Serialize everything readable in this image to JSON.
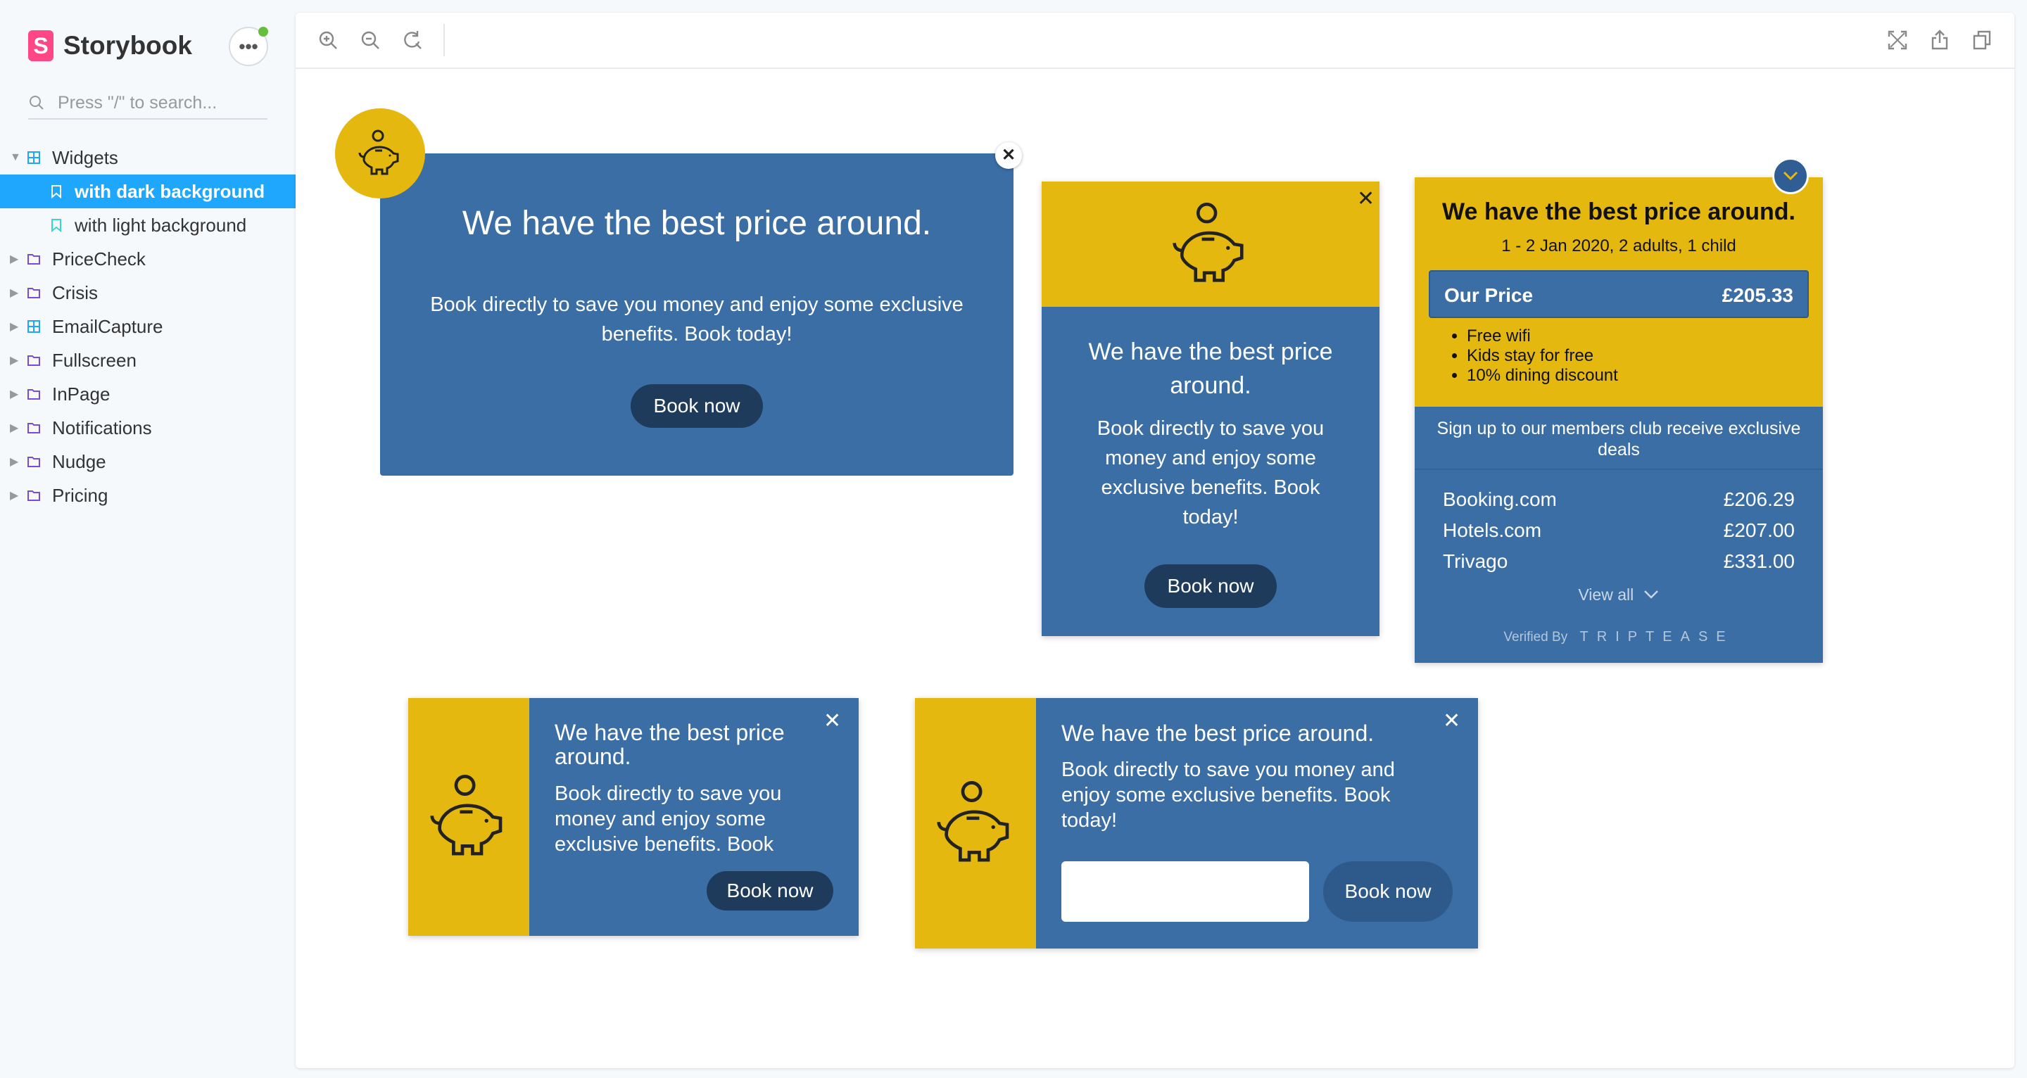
{
  "app": {
    "name": "Storybook",
    "logo_letter": "S"
  },
  "search": {
    "placeholder": "Press \"/\" to search..."
  },
  "sidebar": {
    "items": [
      {
        "label": "Widgets",
        "type": "component",
        "expanded": true
      },
      {
        "label": "with dark background",
        "type": "story",
        "active": true
      },
      {
        "label": "with light background",
        "type": "story"
      },
      {
        "label": "PriceCheck",
        "type": "folder"
      },
      {
        "label": "Crisis",
        "type": "folder"
      },
      {
        "label": "EmailCapture",
        "type": "component"
      },
      {
        "label": "Fullscreen",
        "type": "folder"
      },
      {
        "label": "InPage",
        "type": "folder"
      },
      {
        "label": "Notifications",
        "type": "folder"
      },
      {
        "label": "Nudge",
        "type": "folder"
      },
      {
        "label": "Pricing",
        "type": "folder"
      }
    ]
  },
  "toolbar": {
    "icons": [
      "zoom-in-icon",
      "zoom-out-icon",
      "reset-zoom-icon",
      "fullscreen-icon",
      "share-icon",
      "copy-icon"
    ]
  },
  "colors": {
    "blue": "#3b6ea5",
    "yellow": "#e4b80e",
    "dark_button": "#1f3b5c",
    "active": "#1ea7fd",
    "brand": "#ff4785"
  },
  "widgets": {
    "banner": {
      "title": "We have the best price around.",
      "body": "Book directly to save you money and enjoy some exclusive benefits. Book today!",
      "button": "Book now",
      "close": "✕"
    },
    "card": {
      "title": "We have the best price around.",
      "body": "Book directly to save you money and enjoy some exclusive benefits. Book today!",
      "button": "Book now",
      "close": "✕"
    },
    "pricecheck": {
      "title": "We have the best price around.",
      "subtitle": "1 - 2 Jan 2020, 2 adults, 1 child",
      "our_price_label": "Our Price",
      "our_price": "£205.33",
      "benefits": [
        "Free wifi",
        "Kids stay for free",
        "10% dining discount"
      ],
      "signup": "Sign up to our members club receive exclusive deals",
      "competitors": [
        {
          "name": "Booking.com",
          "price": "£206.29"
        },
        {
          "name": "Hotels.com",
          "price": "£207.00"
        },
        {
          "name": "Trivago",
          "price": "£331.00"
        }
      ],
      "view_all": "View all",
      "verified_by": "Verified By",
      "brand": "TRIPTEASE"
    },
    "notification": {
      "title": "We have the best price around.",
      "body": "Book directly to save you money and enjoy some exclusive benefits. Book",
      "button": "Book now",
      "close": "✕"
    },
    "email_capture": {
      "title": "We have the best price around.",
      "body": "Book directly to save you money and enjoy some exclusive benefits. Book today!",
      "input_value": "",
      "button": "Book now",
      "close": "✕"
    }
  }
}
